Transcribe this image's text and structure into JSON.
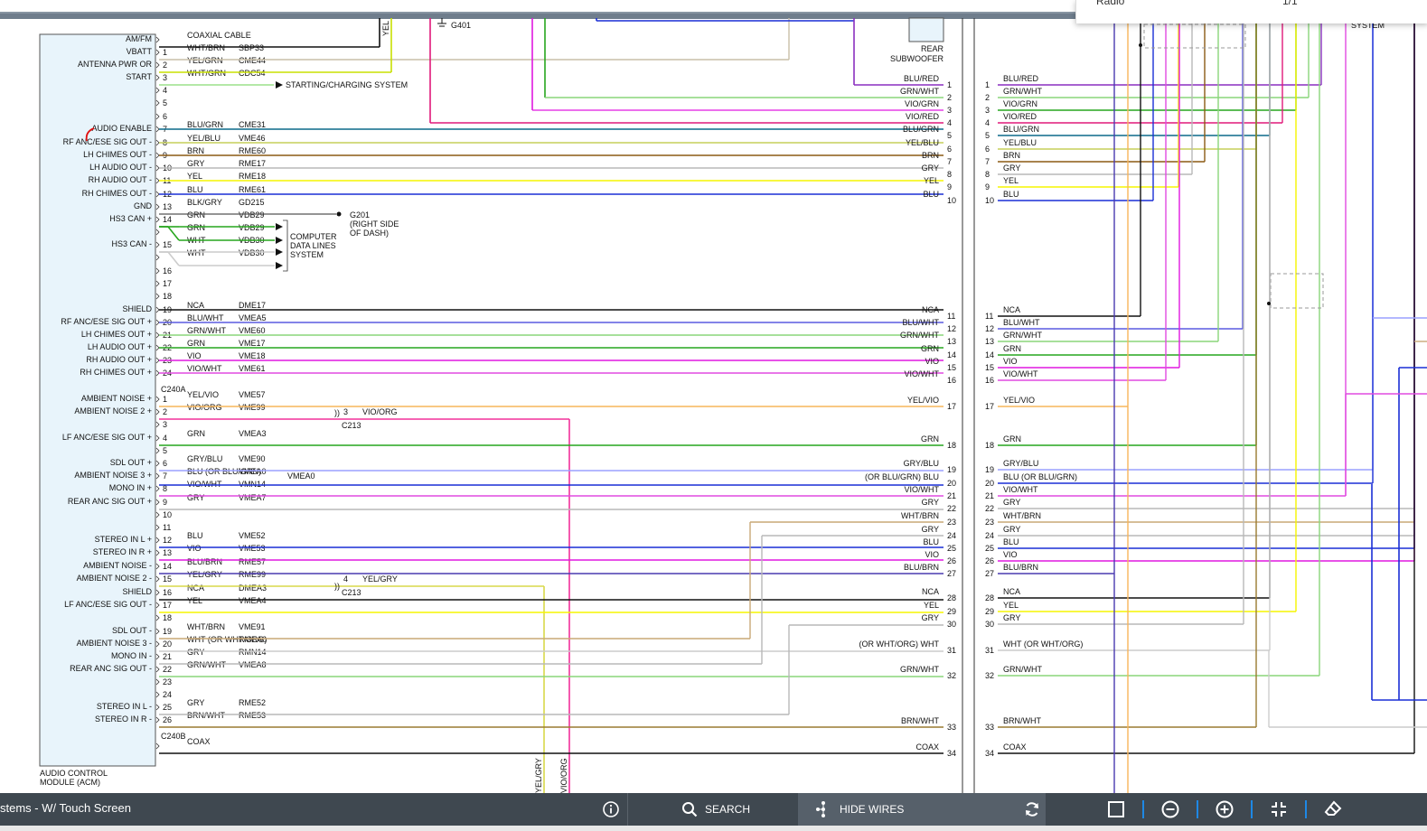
{
  "diagram": {
    "module": {
      "name_line1": "AUDIO CONTROL",
      "name_line2": "MODULE (ACM)"
    },
    "connectors": {
      "c240a": "C240A",
      "c240b": "C240B"
    },
    "wires_a": [
      {
        "pin": "",
        "fn": "AM/FM",
        "color": "COAXIAL CABLE",
        "circuit": "",
        "stroke": "#111111"
      },
      {
        "pin": "1",
        "fn": "VBATT",
        "color": "WHT/BRN",
        "circuit": "SBP33",
        "stroke": "#c9bfa8"
      },
      {
        "pin": "2",
        "fn": "ANTENNA PWR OR",
        "color": "YEL/GRN",
        "circuit": "CME44",
        "stroke": "#c8e000"
      },
      {
        "pin": "3",
        "fn": "START",
        "color": "WHT/GRN",
        "circuit": "CDC54",
        "stroke": "#9be08a"
      },
      {
        "pin": "4",
        "fn": "",
        "color": "",
        "circuit": "",
        "stroke": ""
      },
      {
        "pin": "5",
        "fn": "",
        "color": "",
        "circuit": "",
        "stroke": ""
      },
      {
        "pin": "6",
        "fn": "",
        "color": "",
        "circuit": "",
        "stroke": ""
      },
      {
        "pin": "7",
        "fn": "AUDIO ENABLE",
        "color": "BLU/GRN",
        "circuit": "CME31",
        "stroke": "#0b6a8a"
      },
      {
        "pin": "8",
        "fn": "RF ANC/ESE SIG OUT -",
        "color": "YEL/BLU",
        "circuit": "VME46",
        "stroke": "#c6cf5a"
      },
      {
        "pin": "9",
        "fn": "LH CHIMES OUT -",
        "color": "BRN",
        "circuit": "RME60",
        "stroke": "#8b5a14"
      },
      {
        "pin": "10",
        "fn": "LH AUDIO OUT -",
        "color": "GRY",
        "circuit": "RME17",
        "stroke": "#b8b8b8"
      },
      {
        "pin": "11",
        "fn": "RH AUDIO OUT -",
        "color": "YEL",
        "circuit": "RME18",
        "stroke": "#f5f500"
      },
      {
        "pin": "12",
        "fn": "RH CHIMES OUT -",
        "color": "BLU",
        "circuit": "RME61",
        "stroke": "#1a2fd6"
      },
      {
        "pin": "13",
        "fn": "GND",
        "color": "BLK/GRY",
        "circuit": "GD215",
        "stroke": "#555555"
      },
      {
        "pin": "14",
        "fn": "HS3 CAN +",
        "color": "GRN",
        "circuit": "VDB29",
        "stroke": "#27a61e"
      },
      {
        "pin": "",
        "fn": "",
        "color": "GRN",
        "circuit": "VDB29",
        "stroke": "#27a61e"
      },
      {
        "pin": "15",
        "fn": "HS3 CAN -",
        "color": "WHT",
        "circuit": "VDB30",
        "stroke": "#cccccc"
      },
      {
        "pin": "",
        "fn": "",
        "color": "WHT",
        "circuit": "VDB30",
        "stroke": "#cccccc"
      },
      {
        "pin": "16",
        "fn": "",
        "color": "",
        "circuit": "",
        "stroke": ""
      },
      {
        "pin": "17",
        "fn": "",
        "color": "",
        "circuit": "",
        "stroke": ""
      },
      {
        "pin": "18",
        "fn": "",
        "color": "",
        "circuit": "",
        "stroke": ""
      },
      {
        "pin": "19",
        "fn": "SHIELD",
        "color": "NCA",
        "circuit": "DME17",
        "stroke": "#111111"
      },
      {
        "pin": "20",
        "fn": "RF ANC/ESE SIG OUT +",
        "color": "BLU/WHT",
        "circuit": "VMEA5",
        "stroke": "#5a5ae0"
      },
      {
        "pin": "21",
        "fn": "LH CHIMES OUT +",
        "color": "GRN/WHT",
        "circuit": "VME60",
        "stroke": "#8ad67a"
      },
      {
        "pin": "22",
        "fn": "LH AUDIO OUT +",
        "color": "GRN",
        "circuit": "VME17",
        "stroke": "#27a61e"
      },
      {
        "pin": "23",
        "fn": "RH AUDIO OUT +",
        "color": "VIO",
        "circuit": "VME18",
        "stroke": "#e018e0"
      },
      {
        "pin": "24",
        "fn": "RH CHIMES OUT +",
        "color": "VIO/WHT",
        "circuit": "VME61",
        "stroke": "#e04ae0"
      }
    ],
    "wires_b": [
      {
        "pin": "1",
        "fn": "AMBIENT NOISE +",
        "color": "YEL/VIO",
        "circuit": "VME57",
        "stroke": "#f7b55a"
      },
      {
        "pin": "2",
        "fn": "AMBIENT NOISE 2 +",
        "color": "VIO/ORG",
        "circuit": "VME99",
        "stroke": "#f2309a"
      },
      {
        "pin": "3",
        "fn": "",
        "color": "",
        "circuit": "",
        "stroke": ""
      },
      {
        "pin": "4",
        "fn": "LF ANC/ESE SIG OUT +",
        "color": "GRN",
        "circuit": "VMEA3",
        "stroke": "#27a61e"
      },
      {
        "pin": "5",
        "fn": "",
        "color": "",
        "circuit": "",
        "stroke": ""
      },
      {
        "pin": "6",
        "fn": "SDL OUT +",
        "color": "GRY/BLU",
        "circuit": "VME90",
        "stroke": "#9aa0ff"
      },
      {
        "pin": "7",
        "fn": "AMBIENT NOISE 3 +",
        "color": "BLU  (OR BLU/GRN)",
        "circuit": "VMEA0",
        "stroke": "#1a2fd6"
      },
      {
        "pin": "8",
        "fn": "MONO IN +",
        "color": "VIO/WHT",
        "circuit": "VMN14",
        "stroke": "#e04ae0"
      },
      {
        "pin": "9",
        "fn": "REAR ANC SIG OUT +",
        "color": "GRY",
        "circuit": "VMEA7",
        "stroke": "#b8b8b8"
      },
      {
        "pin": "10",
        "fn": "",
        "color": "",
        "circuit": "",
        "stroke": ""
      },
      {
        "pin": "11",
        "fn": "",
        "color": "",
        "circuit": "",
        "stroke": ""
      },
      {
        "pin": "12",
        "fn": "STEREO IN L +",
        "color": "BLU",
        "circuit": "VME52",
        "stroke": "#1a2fd6"
      },
      {
        "pin": "13",
        "fn": "STEREO IN R +",
        "color": "VIO",
        "circuit": "VME53",
        "stroke": "#e018e0"
      },
      {
        "pin": "14",
        "fn": "AMBIENT NOISE -",
        "color": "BLU/BRN",
        "circuit": "RME57",
        "stroke": "#4a3ab0"
      },
      {
        "pin": "15",
        "fn": "AMBIENT NOISE 2 -",
        "color": "YEL/GRY",
        "circuit": "RME99",
        "stroke": "#d8d84a"
      },
      {
        "pin": "16",
        "fn": "SHIELD",
        "color": "NCA",
        "circuit": "DMEA3",
        "stroke": "#111111"
      },
      {
        "pin": "17",
        "fn": "LF ANC/ESE SIG OUT -",
        "color": "YEL",
        "circuit": "VMEA4",
        "stroke": "#f5f500"
      },
      {
        "pin": "18",
        "fn": "",
        "color": "",
        "circuit": "",
        "stroke": ""
      },
      {
        "pin": "19",
        "fn": "SDL OUT -",
        "color": "WHT/BRN",
        "circuit": "VME91",
        "stroke": "#c9a877"
      },
      {
        "pin": "20",
        "fn": "AMBIENT NOISE 3 -",
        "color": "WHT  (OR WHT/ORG)",
        "circuit": "RMEA0",
        "stroke": "#cccccc"
      },
      {
        "pin": "21",
        "fn": "MONO IN -",
        "color": "GRY",
        "circuit": "RMN14",
        "stroke": "#b8b8b8"
      },
      {
        "pin": "22",
        "fn": "REAR ANC SIG OUT -",
        "color": "GRN/WHT",
        "circuit": "VMEA8",
        "stroke": "#8ad67a"
      },
      {
        "pin": "23",
        "fn": "",
        "color": "",
        "circuit": "",
        "stroke": ""
      },
      {
        "pin": "24",
        "fn": "",
        "color": "",
        "circuit": "",
        "stroke": ""
      },
      {
        "pin": "25",
        "fn": "STEREO IN L -",
        "color": "GRY",
        "circuit": "RME52",
        "stroke": "#b8b8b8"
      },
      {
        "pin": "26",
        "fn": "STEREO IN R -",
        "color": "BRN/WHT",
        "circuit": "RME53",
        "stroke": "#9a7a30"
      },
      {
        "pin": "",
        "fn": "",
        "color": "COAX",
        "circuit": "",
        "stroke": "#111111"
      }
    ],
    "right_block": [
      {
        "num": "1",
        "color": "BLU/RED",
        "stroke": "#8a2fc0"
      },
      {
        "num": "2",
        "color": "GRN/WHT",
        "stroke": "#8ad67a"
      },
      {
        "num": "3",
        "color": "VIO/GRN",
        "stroke": "#27a61e"
      },
      {
        "num": "4",
        "color": "VIO/RED",
        "stroke": "#e0187a"
      },
      {
        "num": "5",
        "color": "BLU/GRN",
        "stroke": "#0b6a8a"
      },
      {
        "num": "6",
        "color": "YEL/BLU",
        "stroke": "#c6cf5a"
      },
      {
        "num": "7",
        "color": "BRN",
        "stroke": "#8b5a14"
      },
      {
        "num": "8",
        "color": "GRY",
        "stroke": "#b8b8b8"
      },
      {
        "num": "9",
        "color": "YEL",
        "stroke": "#f5f500"
      },
      {
        "num": "10",
        "color": "BLU",
        "stroke": "#1a2fd6"
      },
      {
        "num": "11",
        "color": "NCA",
        "stroke": "#111111"
      },
      {
        "num": "12",
        "color": "BLU/WHT",
        "stroke": "#5a5ae0"
      },
      {
        "num": "13",
        "color": "GRN/WHT",
        "stroke": "#8ad67a"
      },
      {
        "num": "14",
        "color": "GRN",
        "stroke": "#27a61e"
      },
      {
        "num": "15",
        "color": "VIO",
        "stroke": "#e018e0"
      },
      {
        "num": "16",
        "color": "VIO/WHT",
        "stroke": "#e04ae0"
      },
      {
        "num": "17",
        "color": "YEL/VIO",
        "stroke": "#f7b55a"
      },
      {
        "num": "18",
        "color": "GRN",
        "stroke": "#27a61e"
      },
      {
        "num": "19",
        "color": "GRY/BLU",
        "stroke": "#9aa0ff"
      },
      {
        "num": "20",
        "color": "(OR BLU/GRN)  BLU",
        "stroke": "#1a2fd6"
      },
      {
        "num": "21",
        "color": "VIO/WHT",
        "stroke": "#e04ae0"
      },
      {
        "num": "22",
        "color": "GRY",
        "stroke": "#b8b8b8"
      },
      {
        "num": "23",
        "color": "WHT/BRN",
        "stroke": "#c9a877"
      },
      {
        "num": "24",
        "color": "GRY",
        "stroke": "#b8b8b8"
      },
      {
        "num": "25",
        "color": "BLU",
        "stroke": "#1a2fd6"
      },
      {
        "num": "26",
        "color": "VIO",
        "stroke": "#e018e0"
      },
      {
        "num": "27",
        "color": "BLU/BRN",
        "stroke": "#4a3ab0"
      },
      {
        "num": "28",
        "color": "NCA",
        "stroke": "#111111"
      },
      {
        "num": "29",
        "color": "YEL",
        "stroke": "#f5f500"
      },
      {
        "num": "30",
        "color": "GRY",
        "stroke": "#b8b8b8"
      },
      {
        "num": "31",
        "color": "(OR WHT/ORG) WHT",
        "stroke": "#cccccc"
      },
      {
        "num": "32",
        "color": "GRN/WHT",
        "stroke": "#8ad67a"
      },
      {
        "num": "33",
        "color": "BRN/WHT",
        "stroke": "#9a7a30"
      },
      {
        "num": "34",
        "color": "COAX",
        "stroke": "#111111"
      }
    ],
    "far_right": [
      {
        "num": "1",
        "color": "BLU/RED"
      },
      {
        "num": "2",
        "color": "GRN/WHT"
      },
      {
        "num": "3",
        "color": "VIO/GRN"
      },
      {
        "num": "4",
        "color": "VIO/RED"
      },
      {
        "num": "5",
        "color": "BLU/GRN"
      },
      {
        "num": "6",
        "color": "YEL/BLU"
      },
      {
        "num": "7",
        "color": "BRN"
      },
      {
        "num": "8",
        "color": "GRY"
      },
      {
        "num": "9",
        "color": "YEL"
      },
      {
        "num": "10",
        "color": "BLU"
      },
      {
        "num": "11",
        "color": "NCA"
      },
      {
        "num": "12",
        "color": "BLU/WHT"
      },
      {
        "num": "13",
        "color": "GRN/WHT"
      },
      {
        "num": "14",
        "color": "GRN"
      },
      {
        "num": "15",
        "color": "VIO"
      },
      {
        "num": "16",
        "color": "VIO/WHT"
      },
      {
        "num": "17",
        "color": "YEL/VIO"
      },
      {
        "num": "18",
        "color": "GRN"
      },
      {
        "num": "19",
        "color": "GRY/BLU"
      },
      {
        "num": "20",
        "color": "BLU  (OR BLU/GRN)"
      },
      {
        "num": "21",
        "color": "VIO/WHT"
      },
      {
        "num": "22",
        "color": "GRY"
      },
      {
        "num": "23",
        "color": "WHT/BRN"
      },
      {
        "num": "24",
        "color": "GRY"
      },
      {
        "num": "25",
        "color": "BLU"
      },
      {
        "num": "26",
        "color": "VIO"
      },
      {
        "num": "27",
        "color": "BLU/BRN"
      },
      {
        "num": "28",
        "color": "NCA"
      },
      {
        "num": "29",
        "color": "YEL"
      },
      {
        "num": "30",
        "color": "GRY"
      },
      {
        "num": "31",
        "color": "WHT  (OR WHT/ORG)"
      },
      {
        "num": "32",
        "color": "GRN/WHT"
      },
      {
        "num": "33",
        "color": "BRN/WHT"
      },
      {
        "num": "34",
        "color": "COAX"
      }
    ],
    "labels": {
      "ground_g401": "G401",
      "ground_g201": "G201",
      "g201_note1": "(RIGHT SIDE",
      "g201_note2": "OF DASH)",
      "starting_charging": "STARTING/CHARGING SYSTEM",
      "data_lines_1": "COMPUTER",
      "data_lines_2": "DATA LINES",
      "data_lines_3": "SYSTEM",
      "subwoofer_1": "REAR",
      "subwoofer_2": "SUBWOOFER",
      "c213": "C213",
      "c213_pin3": "3",
      "c213_pin3_color": "VIO/ORG",
      "c213_pin4": "4",
      "c213_pin4_color": "YEL/GRY",
      "vert_yel_top": "YEL",
      "vert_yelgry": "YEL/GRY",
      "vert_vioorg": "VIO/ORG",
      "system_top": "SYSTEM",
      "popup_left": "Radio",
      "popup_right": "1/1"
    }
  },
  "toolbar": {
    "title": "stems - W/ Touch Screen",
    "search": "SEARCH",
    "hide_wires": "HIDE WIRES"
  }
}
